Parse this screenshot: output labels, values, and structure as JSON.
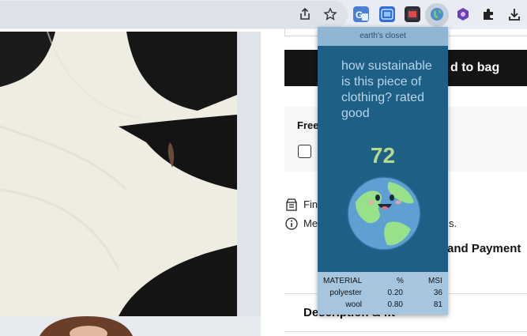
{
  "browser": {
    "icons": {
      "share": "share-icon",
      "bookmark": "star-icon",
      "translate": "translate-icon",
      "extensions": "puzzle-icon",
      "download": "download-icon"
    }
  },
  "product_page": {
    "add_to_bag_label": "d to bag",
    "free_label": "Free",
    "info_rows": [
      {
        "text": "Fin",
        "icon": "store-icon"
      },
      {
        "text": "Me",
        "icon": "info-icon"
      }
    ],
    "info_row_tail": "s.",
    "payment_label": "and Payment",
    "description_label": "Description & fit"
  },
  "extension_popup": {
    "header": "earth's closet",
    "question": "how sustainable is this piece of clothing? rated good",
    "score": "72",
    "table": {
      "headers": [
        "MATERIAL",
        "%",
        "MSI"
      ],
      "rows": [
        {
          "material": "polyester",
          "percent": "0.20",
          "msi": "36"
        },
        {
          "material": "wool",
          "percent": "0.80",
          "msi": "81"
        }
      ]
    },
    "colors": {
      "background": "#1e5f86",
      "header_bg": "#8fb6d4",
      "score": "#b7d98f",
      "text": "#b8d4ea"
    }
  }
}
